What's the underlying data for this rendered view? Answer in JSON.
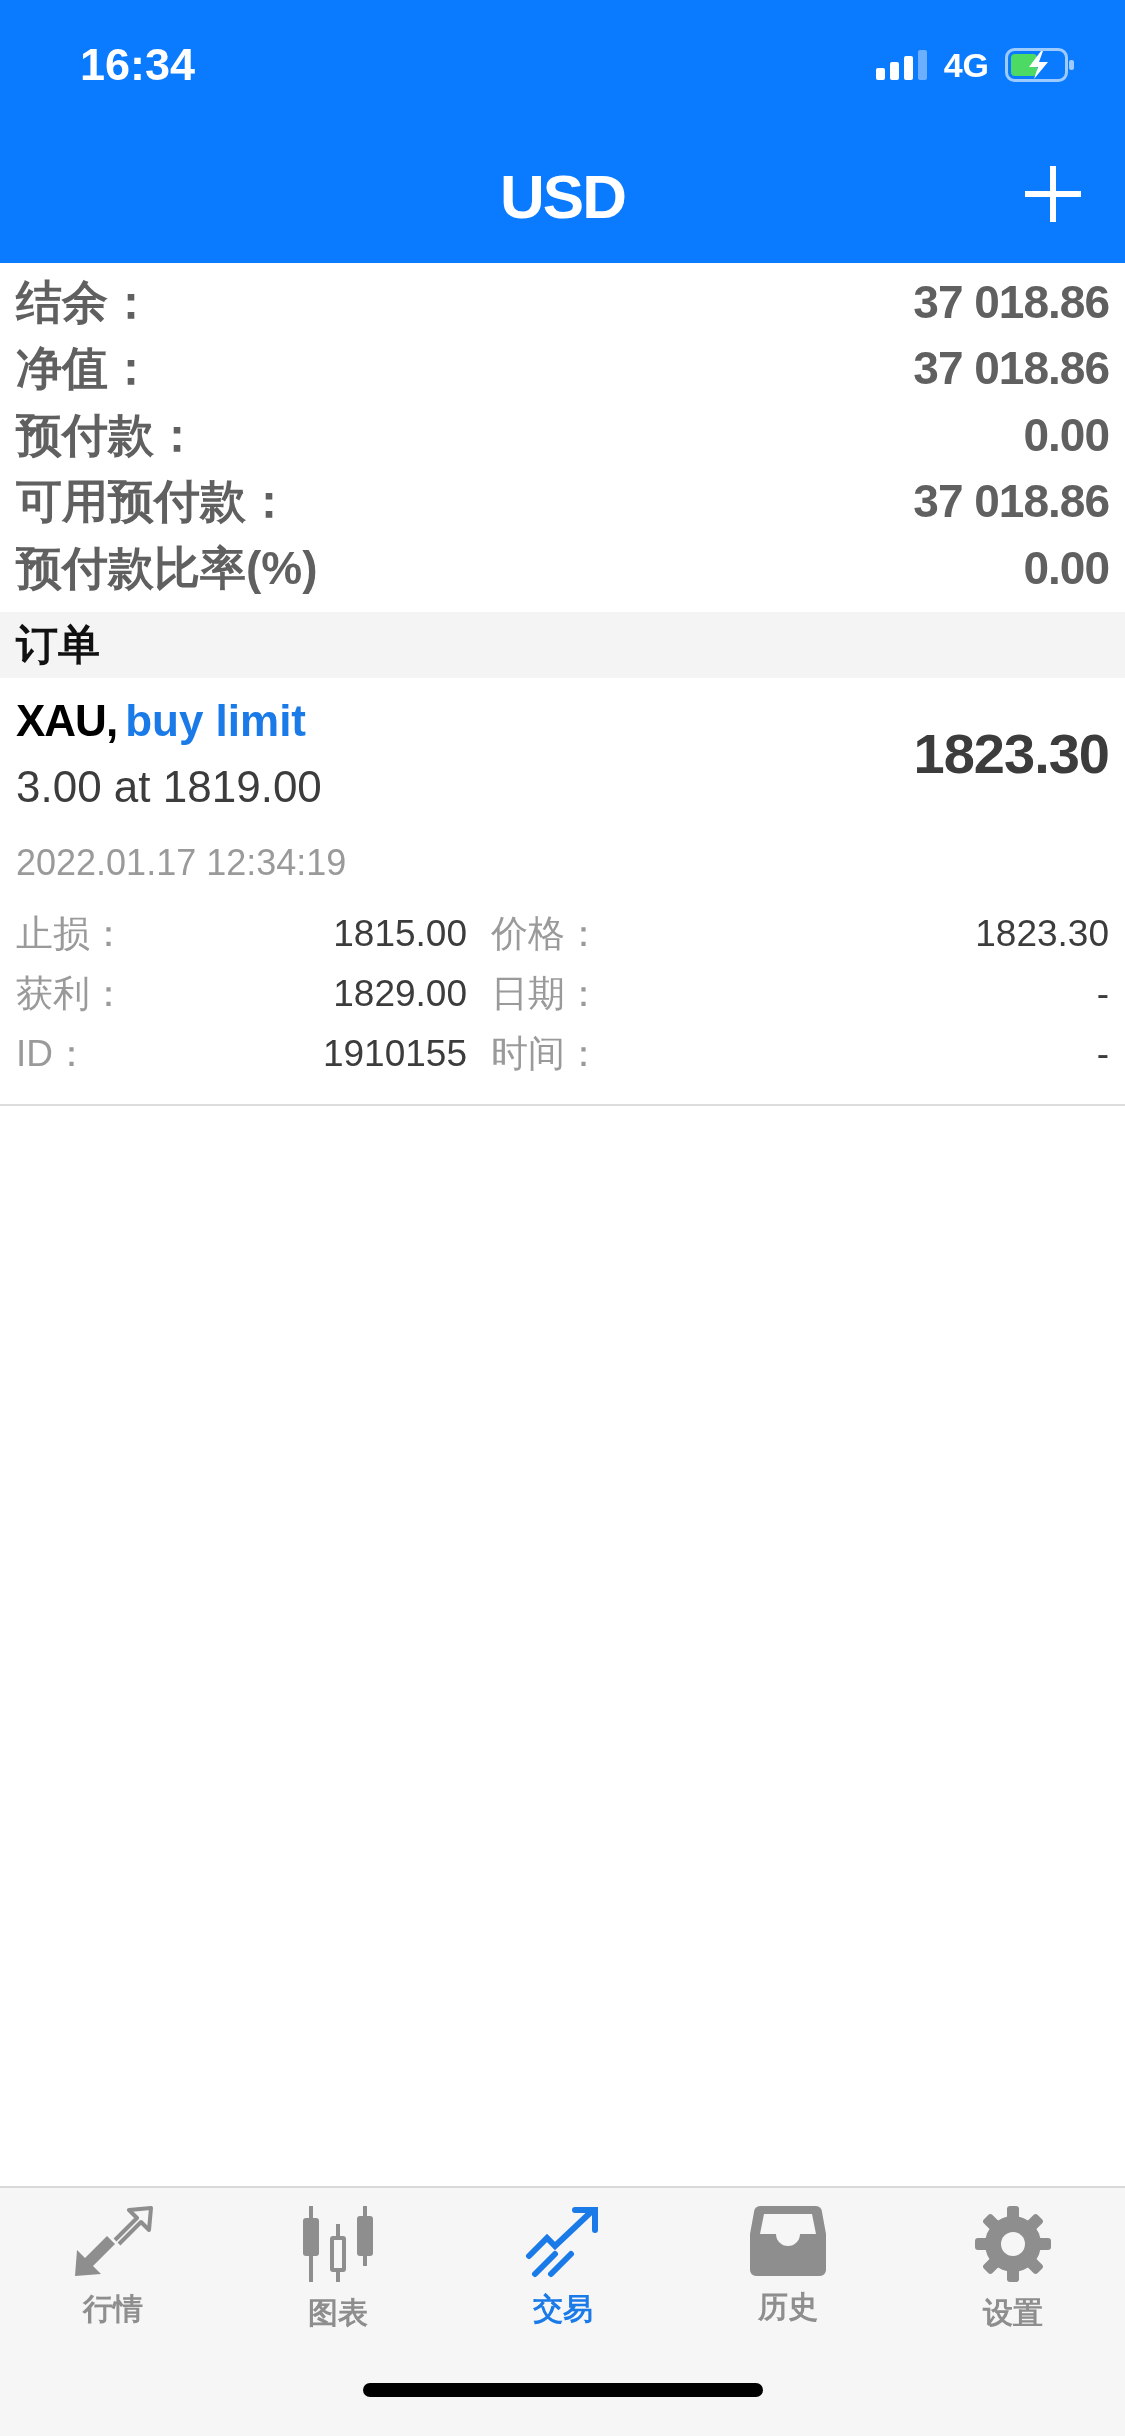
{
  "status_bar": {
    "time": "16:34",
    "network": "4G"
  },
  "header": {
    "title": "USD"
  },
  "summary": [
    {
      "label": "结余：",
      "value": "37 018.86"
    },
    {
      "label": "净值：",
      "value": "37 018.86"
    },
    {
      "label": "预付款：",
      "value": "0.00"
    },
    {
      "label": "可用预付款：",
      "value": "37 018.86"
    },
    {
      "label": "预付款比率(%)",
      "value": "0.00"
    }
  ],
  "orders_section": {
    "title": "订单"
  },
  "orders": [
    {
      "symbol": "XAU,",
      "type": "buy limit",
      "volume_line": "3.00 at 1819.00",
      "price": "1823.30",
      "time": "2022.01.17 12:34:19",
      "details": [
        [
          {
            "label": "止损：",
            "value": "1815.00"
          },
          {
            "label": "价格：",
            "value": "1823.30"
          }
        ],
        [
          {
            "label": "获利：",
            "value": "1829.00"
          },
          {
            "label": "日期：",
            "value": "-"
          }
        ],
        [
          {
            "label": "ID：",
            "value": "1910155"
          },
          {
            "label": "时间：",
            "value": "-"
          }
        ]
      ]
    }
  ],
  "tabs": [
    {
      "label": "行情",
      "selected": false
    },
    {
      "label": "图表",
      "selected": false
    },
    {
      "label": "交易",
      "selected": true
    },
    {
      "label": "历史",
      "selected": false
    },
    {
      "label": "设置",
      "selected": false
    }
  ]
}
